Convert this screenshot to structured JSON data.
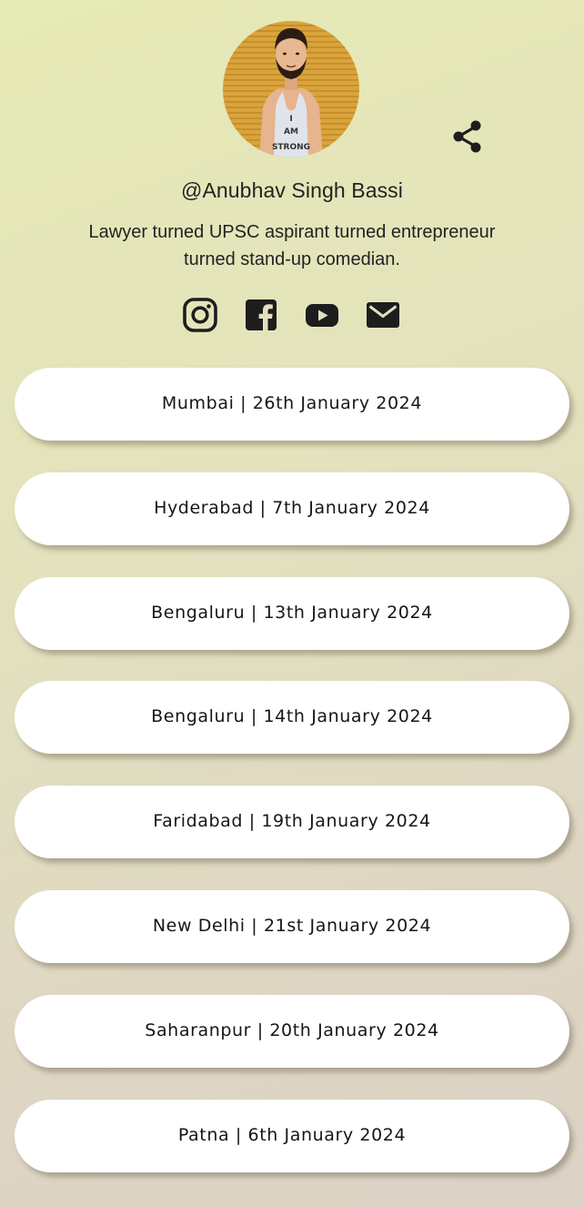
{
  "profile": {
    "username": "@Anubhav Singh Bassi",
    "bio": "Lawyer turned UPSC aspirant turned entrepreneur turned stand-up comedian.",
    "avatar_shirt_text": [
      "I",
      "AM",
      "STRONG"
    ]
  },
  "icons": {
    "share": "share-icon",
    "socials": [
      "instagram-icon",
      "facebook-icon",
      "youtube-icon",
      "email-icon"
    ]
  },
  "links": [
    {
      "label": "Mumbai | 26th January 2024"
    },
    {
      "label": "Hyderabad | 7th January 2024"
    },
    {
      "label": "Bengaluru | 13th January 2024"
    },
    {
      "label": "Bengaluru | 14th January 2024"
    },
    {
      "label": "Faridabad | 19th January 2024"
    },
    {
      "label": "New Delhi | 21st January 2024"
    },
    {
      "label": "Saharanpur | 20th January 2024"
    },
    {
      "label": "Patna | 6th January 2024"
    }
  ],
  "colors": {
    "background_start": "#e6eab5",
    "background_end": "#dcd2c6",
    "button_bg": "#ffffff",
    "icon_color": "#1d1d1d",
    "avatar_bg": "#d9a43c"
  }
}
